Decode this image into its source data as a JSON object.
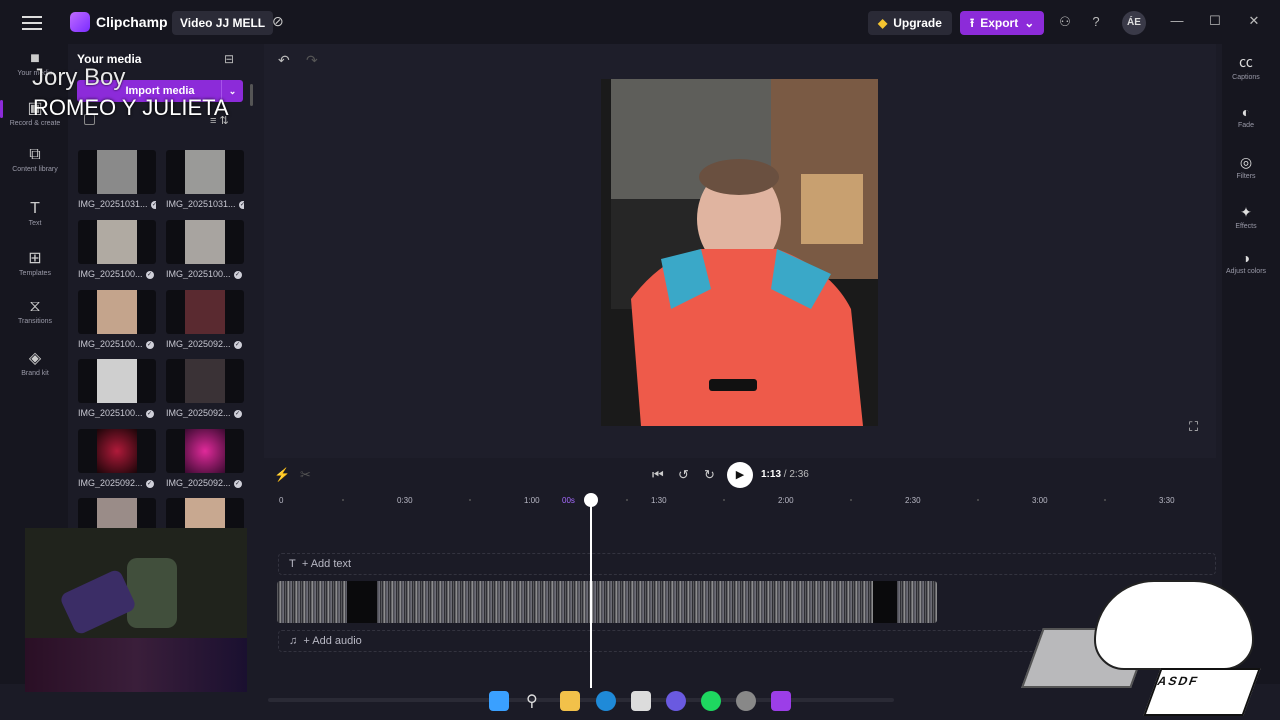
{
  "app": {
    "name": "Clipchamp",
    "project": "Video JJ MELL"
  },
  "topbar": {
    "upgrade": "Upgrade",
    "export": "Export",
    "avatar": "ÁE"
  },
  "rail": [
    {
      "label": "Your media",
      "icon": "folder-icon"
    },
    {
      "label": "Record & create",
      "icon": "record-icon"
    },
    {
      "label": "Content library",
      "icon": "library-icon"
    },
    {
      "label": "Text",
      "icon": "text-icon"
    },
    {
      "label": "Templates",
      "icon": "templates-icon"
    },
    {
      "label": "Transitions",
      "icon": "transitions-icon"
    },
    {
      "label": "Brand kit",
      "icon": "brand-kit-icon"
    }
  ],
  "media": {
    "title": "Your media",
    "import": "Import media",
    "items": [
      {
        "name": "IMG_20251031..."
      },
      {
        "name": "IMG_20251031..."
      },
      {
        "name": "IMG_2025100..."
      },
      {
        "name": "IMG_2025100..."
      },
      {
        "name": "IMG_2025100..."
      },
      {
        "name": "IMG_2025092..."
      },
      {
        "name": "IMG_2025100..."
      },
      {
        "name": "IMG_2025092..."
      },
      {
        "name": "IMG_2025092..."
      },
      {
        "name": "IMG_2025092..."
      },
      {
        "name": ""
      },
      {
        "name": ""
      }
    ]
  },
  "overlay": {
    "line1": "Jory Boy",
    "line2": "ROMEO Y JULIETA"
  },
  "right_rail": [
    {
      "label": "Captions",
      "icon": "captions-icon"
    },
    {
      "label": "Fade",
      "icon": "fade-icon"
    },
    {
      "label": "Filters",
      "icon": "filters-icon"
    },
    {
      "label": "Effects",
      "icon": "effects-icon"
    },
    {
      "label": "Adjust colors",
      "icon": "adjust-colors-icon"
    }
  ],
  "playback": {
    "current": "1:13",
    "total": "/ 2:36"
  },
  "ruler": [
    "0",
    "0:30",
    "1:00",
    "1:30",
    "2:00",
    "2:30",
    "3:00",
    "3:30"
  ],
  "ruler_playhead_label": "00s",
  "tracks": {
    "add_text": "+ Add text",
    "add_audio": "+ Add audio"
  },
  "sticker": {
    "keyboard_text": "ASDF"
  },
  "colors": {
    "accent": "#8c2bd9",
    "gem": "#f4c430",
    "bg": "#1b1b26"
  }
}
